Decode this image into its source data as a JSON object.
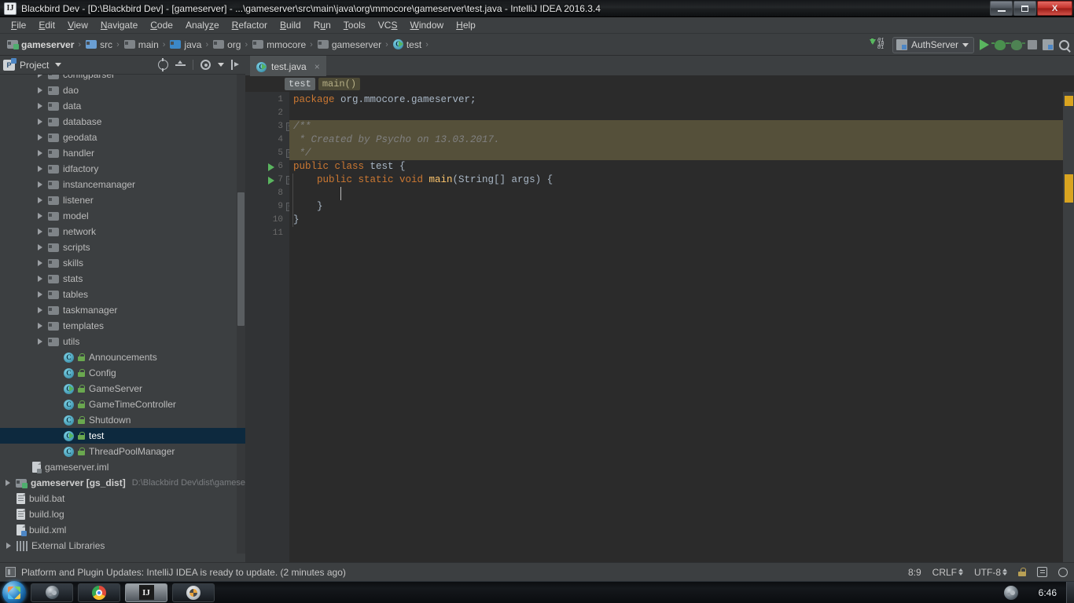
{
  "window": {
    "title": "Blackbird Dev - [D:\\Blackbird Dev] - [gameserver] - ...\\gameserver\\src\\main\\java\\org\\mmocore\\gameserver\\test.java - IntelliJ IDEA 2016.3.4",
    "app_icon": "IJ",
    "buttons": {
      "minimize": "minimize-icon",
      "maximize": "maximize-icon",
      "close": "X"
    }
  },
  "menubar": {
    "items": [
      {
        "label": "File",
        "mnemonic": "F"
      },
      {
        "label": "Edit",
        "mnemonic": "E"
      },
      {
        "label": "View",
        "mnemonic": "V"
      },
      {
        "label": "Navigate",
        "mnemonic": "N"
      },
      {
        "label": "Code",
        "mnemonic": "C"
      },
      {
        "label": "Analyze",
        "mnemonic": "z"
      },
      {
        "label": "Refactor",
        "mnemonic": "R"
      },
      {
        "label": "Build",
        "mnemonic": "B"
      },
      {
        "label": "Run",
        "mnemonic": "u"
      },
      {
        "label": "Tools",
        "mnemonic": "T"
      },
      {
        "label": "VCS",
        "mnemonic": "S"
      },
      {
        "label": "Window",
        "mnemonic": "W"
      },
      {
        "label": "Help",
        "mnemonic": "H"
      }
    ]
  },
  "navbar": {
    "breadcrumbs": [
      {
        "label": "gameserver",
        "icon": "module-folder-icon"
      },
      {
        "label": "src",
        "icon": "source-folder-icon"
      },
      {
        "label": "main",
        "icon": "folder-icon"
      },
      {
        "label": "java",
        "icon": "source-folder-icon"
      },
      {
        "label": "org",
        "icon": "package-folder-icon"
      },
      {
        "label": "mmocore",
        "icon": "package-folder-icon"
      },
      {
        "label": "gameserver",
        "icon": "package-folder-icon"
      },
      {
        "label": "test",
        "icon": "java-class-icon"
      }
    ],
    "separator": "›",
    "run_config": {
      "label": "AuthServer",
      "icon": "run-config-icon"
    },
    "actions": [
      {
        "name": "update-indicator-icon"
      },
      {
        "name": "run-button"
      },
      {
        "name": "debug-button"
      },
      {
        "name": "run-with-coverage-button"
      },
      {
        "name": "stop-button"
      },
      {
        "name": "layout-button"
      },
      {
        "name": "search-everywhere-button"
      }
    ]
  },
  "project_panel": {
    "title": "Project",
    "actions": [
      "select-opened-file-icon",
      "collapse-all-icon",
      "settings-gear-icon",
      "hide-icon"
    ],
    "tree": [
      {
        "label": "configparser",
        "indent": 2,
        "icon": "folder",
        "arrow": true,
        "clipped": true
      },
      {
        "label": "dao",
        "indent": 2,
        "icon": "folder",
        "arrow": true
      },
      {
        "label": "data",
        "indent": 2,
        "icon": "folder",
        "arrow": true
      },
      {
        "label": "database",
        "indent": 2,
        "icon": "folder",
        "arrow": true
      },
      {
        "label": "geodata",
        "indent": 2,
        "icon": "folder",
        "arrow": true
      },
      {
        "label": "handler",
        "indent": 2,
        "icon": "folder",
        "arrow": true
      },
      {
        "label": "idfactory",
        "indent": 2,
        "icon": "folder",
        "arrow": true
      },
      {
        "label": "instancemanager",
        "indent": 2,
        "icon": "folder",
        "arrow": true
      },
      {
        "label": "listener",
        "indent": 2,
        "icon": "folder",
        "arrow": true
      },
      {
        "label": "model",
        "indent": 2,
        "icon": "folder",
        "arrow": true
      },
      {
        "label": "network",
        "indent": 2,
        "icon": "folder",
        "arrow": true
      },
      {
        "label": "scripts",
        "indent": 2,
        "icon": "folder",
        "arrow": true
      },
      {
        "label": "skills",
        "indent": 2,
        "icon": "folder",
        "arrow": true
      },
      {
        "label": "stats",
        "indent": 2,
        "icon": "folder",
        "arrow": true
      },
      {
        "label": "tables",
        "indent": 2,
        "icon": "folder",
        "arrow": true
      },
      {
        "label": "taskmanager",
        "indent": 2,
        "icon": "folder",
        "arrow": true
      },
      {
        "label": "templates",
        "indent": 2,
        "icon": "folder",
        "arrow": true
      },
      {
        "label": "utils",
        "indent": 2,
        "icon": "folder",
        "arrow": true
      },
      {
        "label": "Announcements",
        "indent": 3,
        "icon": "class"
      },
      {
        "label": "Config",
        "indent": 3,
        "icon": "class"
      },
      {
        "label": "GameServer",
        "indent": 3,
        "icon": "class-runnable"
      },
      {
        "label": "GameTimeController",
        "indent": 3,
        "icon": "class"
      },
      {
        "label": "Shutdown",
        "indent": 3,
        "icon": "class"
      },
      {
        "label": "test",
        "indent": 3,
        "icon": "class-runnable",
        "selected": true
      },
      {
        "label": "ThreadPoolManager",
        "indent": 3,
        "icon": "class"
      },
      {
        "label": "gameserver.iml",
        "indent": 1,
        "icon": "iml-file"
      },
      {
        "label": "gameserver [gs_dist]",
        "indent": 0,
        "icon": "module-folder",
        "arrow": true,
        "bold": true,
        "sublabel": "D:\\Blackbird Dev\\dist\\gamese"
      },
      {
        "label": "build.bat",
        "indent": 0,
        "icon": "bat-file"
      },
      {
        "label": "build.log",
        "indent": 0,
        "icon": "bat-file"
      },
      {
        "label": "build.xml",
        "indent": 0,
        "icon": "xml-file"
      },
      {
        "label": "External Libraries",
        "indent": 0,
        "icon": "libraries",
        "arrow": true
      }
    ]
  },
  "editor": {
    "tab": {
      "label": "test.java",
      "icon": "java-class-icon",
      "close": "×"
    },
    "breadcrumbs": [
      {
        "label": "test",
        "kind": "class"
      },
      {
        "label": "main()",
        "kind": "method"
      }
    ],
    "line_numbers": [
      "1",
      "2",
      "3",
      "4",
      "5",
      "6",
      "7",
      "8",
      "9",
      "10",
      "11"
    ],
    "lines": [
      {
        "n": 1,
        "tokens": [
          {
            "t": "package ",
            "c": "kw"
          },
          {
            "t": "org.mmocore.gameserver;",
            "c": "plain"
          }
        ]
      },
      {
        "n": 2,
        "tokens": []
      },
      {
        "n": 3,
        "tokens": [
          {
            "t": "/**",
            "c": "cmt"
          }
        ],
        "highlight": true
      },
      {
        "n": 4,
        "tokens": [
          {
            "t": " * Created by Psycho on 13.03.2017.",
            "c": "cmt"
          }
        ],
        "highlight": true
      },
      {
        "n": 5,
        "tokens": [
          {
            "t": " */",
            "c": "cmt"
          }
        ],
        "highlight": true
      },
      {
        "n": 6,
        "tokens": [
          {
            "t": "public class ",
            "c": "kw"
          },
          {
            "t": "test ",
            "c": "plain"
          },
          {
            "t": "{",
            "c": "plain"
          }
        ]
      },
      {
        "n": 7,
        "tokens": [
          {
            "t": "    public static void ",
            "c": "kw"
          },
          {
            "t": "main",
            "c": "fn"
          },
          {
            "t": "(String[] args) {",
            "c": "plain"
          }
        ]
      },
      {
        "n": 8,
        "tokens": []
      },
      {
        "n": 9,
        "tokens": [
          {
            "t": "    }",
            "c": "plain"
          }
        ]
      },
      {
        "n": 10,
        "tokens": [
          {
            "t": "}",
            "c": "plain"
          }
        ]
      },
      {
        "n": 11,
        "tokens": []
      }
    ],
    "fold_markers": [
      {
        "line": 3,
        "glyph": "−"
      },
      {
        "line": 5,
        "glyph": "−"
      },
      {
        "line": 7,
        "glyph": "−"
      },
      {
        "line": 9,
        "glyph": "−"
      }
    ],
    "run_gutter_lines": [
      6,
      7
    ]
  },
  "statusbar": {
    "message": "Platform and Plugin Updates: IntelliJ IDEA is ready to update. (2 minutes ago)",
    "caret_position": "8:9",
    "line_separator": "CRLF",
    "encoding": "UTF-8",
    "icons": [
      "lock-icon",
      "hierarchy-icon",
      "search-icon"
    ]
  },
  "taskbar": {
    "start_label": "start-orb",
    "tasks": [
      {
        "name": "steam-taskbar-button",
        "icon": "steam-icon"
      },
      {
        "name": "chrome-taskbar-button",
        "icon": "chrome-icon"
      },
      {
        "name": "intellij-taskbar-button",
        "icon": "IJ",
        "active": true
      },
      {
        "name": "media-player-taskbar-button",
        "icon": "media-icon"
      }
    ],
    "tray": {
      "steam": "steam-tray-icon",
      "clock": "6:46"
    }
  },
  "colors": {
    "editor_bg": "#2b2b2b",
    "panel_bg": "#3c3f41",
    "selection": "#0d293e",
    "keyword": "#cc7832",
    "identifier": "#a9b7c6",
    "comment": "#808080",
    "method": "#ffc66d",
    "comment_highlight": "#55503a",
    "marker": "#d9a420"
  }
}
